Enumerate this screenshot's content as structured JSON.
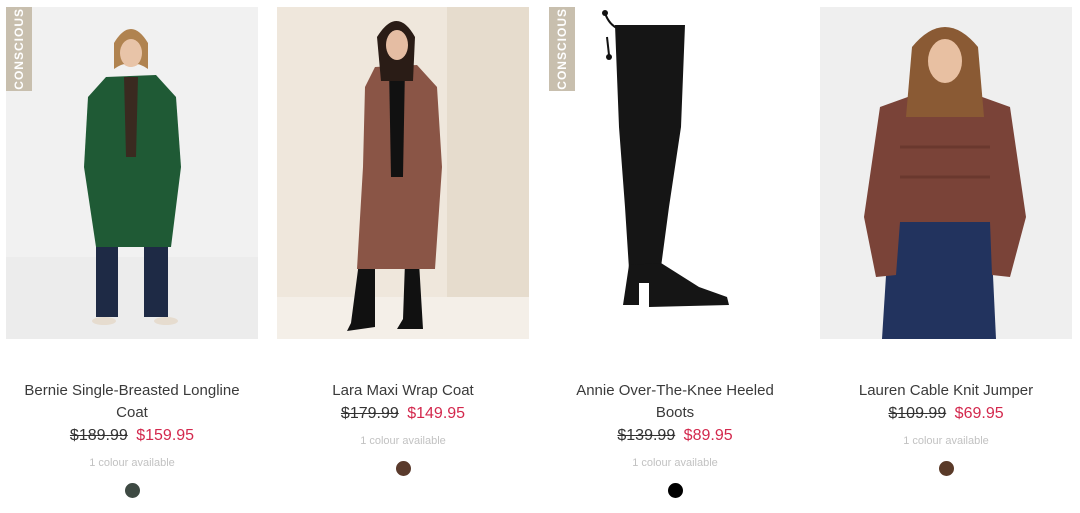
{
  "badge_label": "CONSCIOUS",
  "products": [
    {
      "name": "Bernie Single-Breasted Longline Coat",
      "badge": "CONSCIOUS",
      "original_price": "$189.99",
      "sale_price": "$159.95",
      "colours_text": "1 colour available",
      "swatch_color": "#3e4a43",
      "image_icon": "green-coat-photo"
    },
    {
      "name": "Lara Maxi Wrap Coat",
      "badge": "",
      "original_price": "$179.99",
      "sale_price": "$149.95",
      "colours_text": "1 colour available",
      "swatch_color": "#5a3a2c",
      "image_icon": "brown-coat-photo"
    },
    {
      "name": "Annie Over-The-Knee Heeled Boots",
      "badge": "CONSCIOUS",
      "original_price": "$139.99",
      "sale_price": "$89.95",
      "colours_text": "1 colour available",
      "swatch_color": "#000000",
      "image_icon": "black-boot-photo"
    },
    {
      "name": "Lauren Cable Knit Jumper",
      "badge": "",
      "original_price": "$109.99",
      "sale_price": "$69.95",
      "colours_text": "1 colour available",
      "swatch_color": "#5a3a28",
      "image_icon": "knit-jumper-photo"
    }
  ],
  "colors": {
    "sale_price": "#d3284d",
    "badge_bg": "#c8bfae"
  }
}
